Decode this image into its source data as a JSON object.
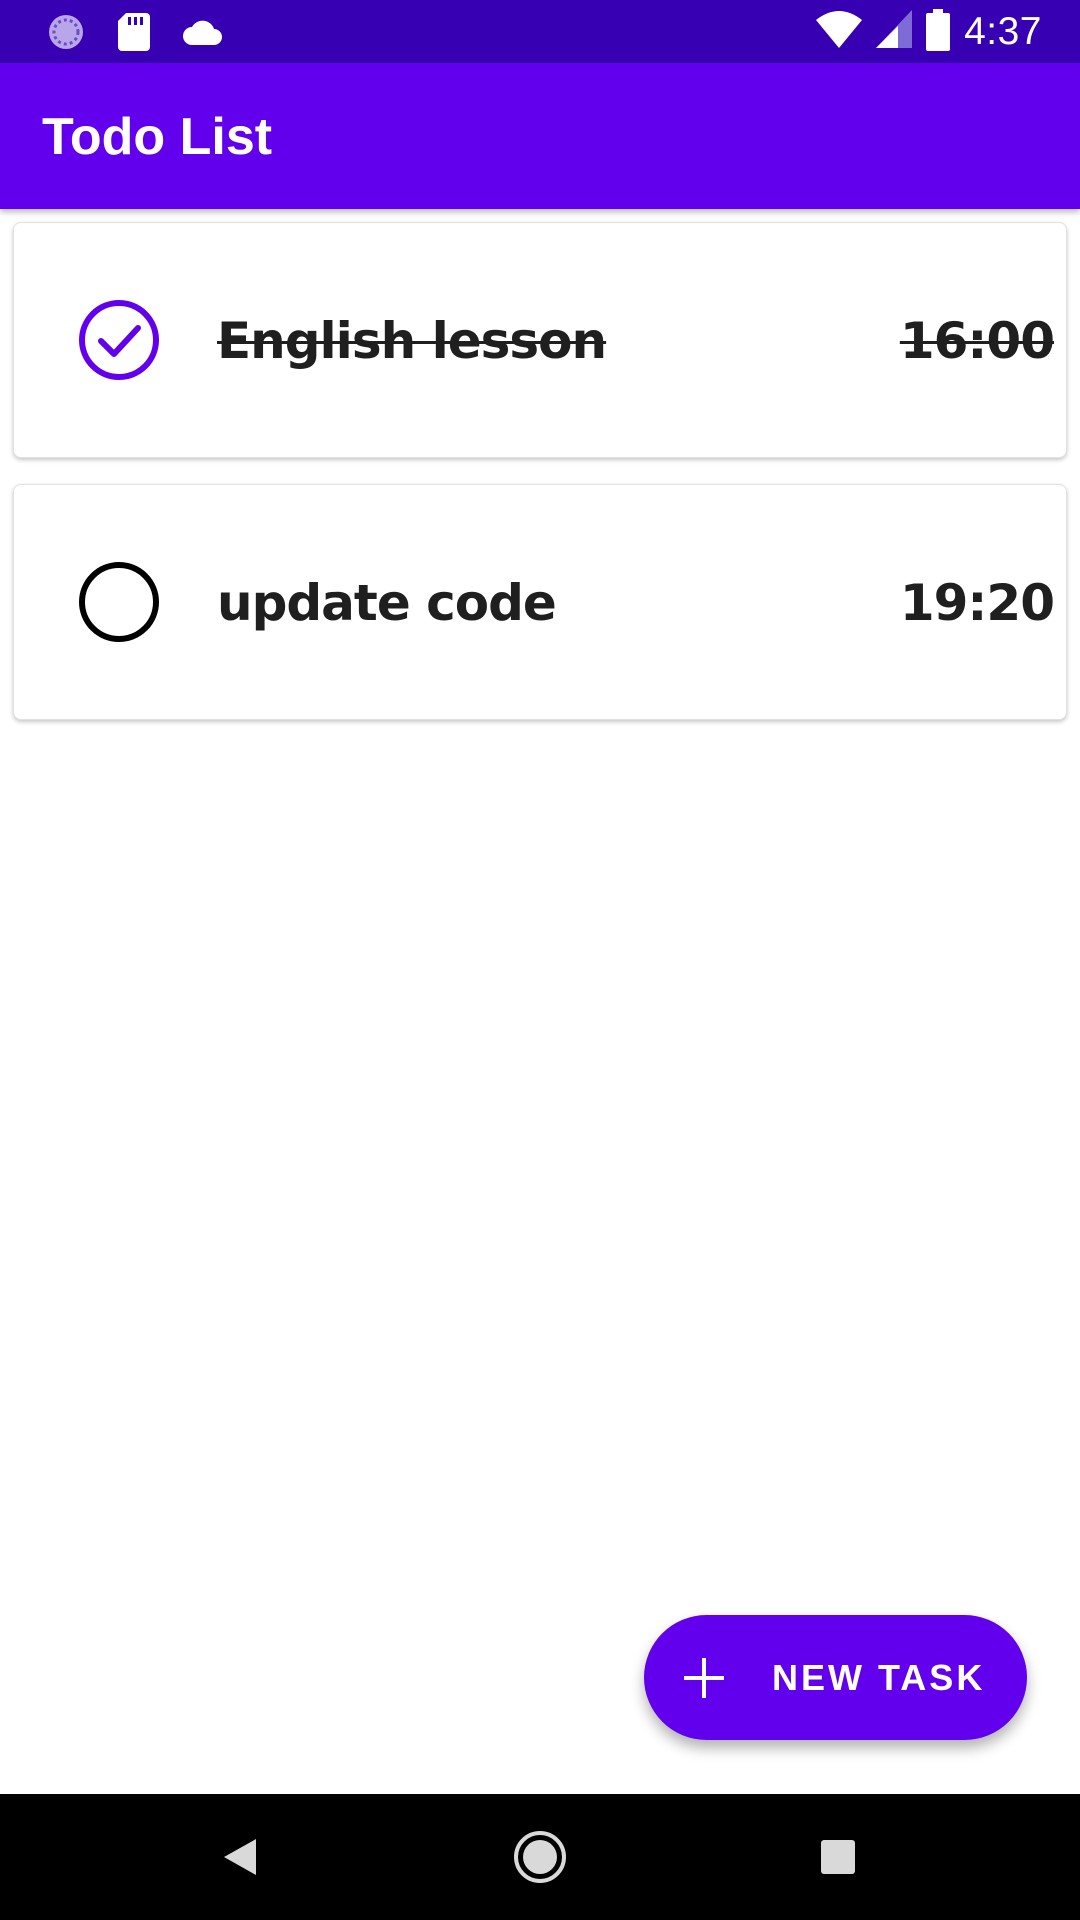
{
  "status_bar": {
    "time": "4:37",
    "left_icons": [
      "sync-icon",
      "sd-card-icon",
      "cloud-icon"
    ],
    "right_icons": [
      "wifi-icon",
      "cell-signal-icon",
      "battery-icon"
    ]
  },
  "app_bar": {
    "title": "Todo List"
  },
  "tasks": [
    {
      "name": "English lesson",
      "time": "16:00",
      "done": true
    },
    {
      "name": "update code",
      "time": "19:20",
      "done": false
    }
  ],
  "fab": {
    "label": "NEW TASK",
    "icon": "plus-icon"
  },
  "nav_bar": {
    "buttons": [
      "back-icon",
      "home-icon",
      "recents-icon"
    ]
  },
  "colors": {
    "status_bar": "#3700B3",
    "primary": "#6200EE",
    "text": "#1f1f1f"
  }
}
